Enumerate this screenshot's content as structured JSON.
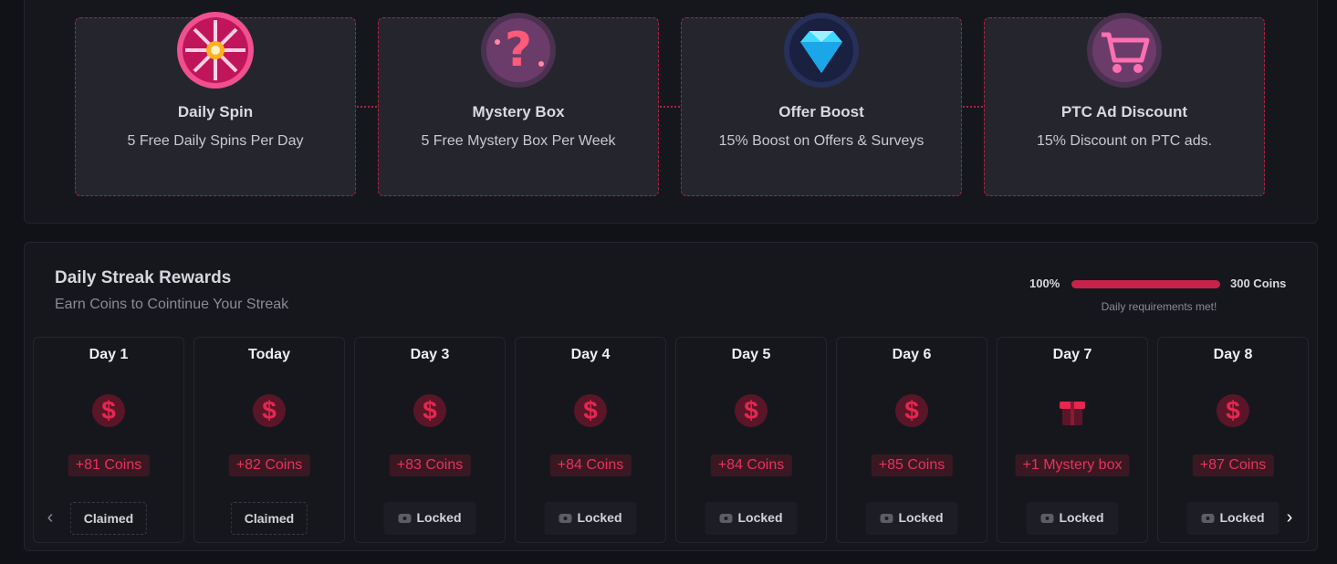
{
  "perks": [
    {
      "title": "Daily Spin",
      "desc": "5 Free Daily Spins Per Day",
      "icon": "spin-wheel-icon"
    },
    {
      "title": "Mystery Box",
      "desc": "5 Free Mystery Box Per Week",
      "icon": "mystery-box-icon"
    },
    {
      "title": "Offer Boost",
      "desc": "15% Boost on Offers & Surveys",
      "icon": "diamond-icon"
    },
    {
      "title": "PTC Ad Discount",
      "desc": "15% Discount on PTC ads.",
      "icon": "shopping-cart-icon"
    }
  ],
  "streak": {
    "title": "Daily Streak Rewards",
    "subtitle": "Earn Coins to Cointinue Your Streak",
    "progress_percent_label": "100%",
    "progress_fraction": 1.0,
    "goal_label": "300 Coins",
    "requirement_text": "Daily requirements met!",
    "days": [
      {
        "label": "Day 1",
        "reward": "+81 Coins",
        "status": "Claimed",
        "icon": "dollar-coin-icon"
      },
      {
        "label": "Today",
        "reward": "+82 Coins",
        "status": "Claimed",
        "icon": "dollar-coin-icon"
      },
      {
        "label": "Day 3",
        "reward": "+83 Coins",
        "status": "Locked",
        "icon": "dollar-coin-icon"
      },
      {
        "label": "Day 4",
        "reward": "+84 Coins",
        "status": "Locked",
        "icon": "dollar-coin-icon"
      },
      {
        "label": "Day 5",
        "reward": "+84 Coins",
        "status": "Locked",
        "icon": "dollar-coin-icon"
      },
      {
        "label": "Day 6",
        "reward": "+85 Coins",
        "status": "Locked",
        "icon": "dollar-coin-icon"
      },
      {
        "label": "Day 7",
        "reward": "+1 Mystery box",
        "status": "Locked",
        "icon": "gift-icon"
      },
      {
        "label": "Day 8",
        "reward": "+87 Coins",
        "status": "Locked",
        "icon": "dollar-coin-icon"
      }
    ]
  },
  "colors": {
    "accent": "#c9224a",
    "background": "#111217",
    "card": "#25252e"
  },
  "coin_symbol": "$",
  "nav": {
    "prev_icon": "chevron-left-icon",
    "next_icon": "chevron-right-icon",
    "prev_glyph": "‹",
    "next_glyph": "›"
  }
}
